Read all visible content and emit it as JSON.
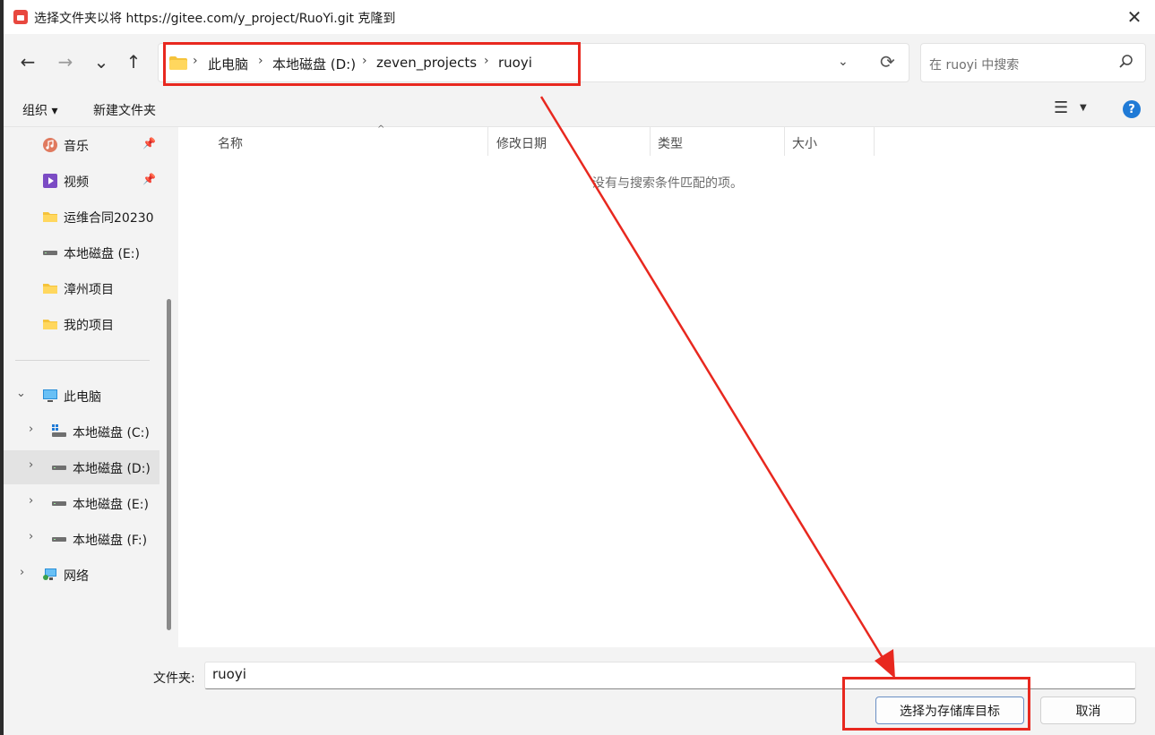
{
  "window": {
    "title": "选择文件夹以将 https://gitee.com/y_project/RuoYi.git 克隆到",
    "close_label": "✕"
  },
  "nav": {
    "back_icon": "←",
    "forward_icon": "→",
    "recent_icon": "⌄",
    "up_icon": "↑"
  },
  "address": {
    "crumbs": [
      "此电脑",
      "本地磁盘 (D:)",
      "zeven_projects",
      "ruoyi"
    ],
    "separator": "›",
    "dropdown_icon": "⌄",
    "refresh_icon": "⟳"
  },
  "search": {
    "placeholder": "在 ruoyi 中搜索",
    "icon": "search-icon"
  },
  "toolbar": {
    "organize_label": "组织 ▾",
    "new_folder_label": "新建文件夹",
    "view_icon": "☰",
    "view_dropdown": "▼",
    "help_label": "?"
  },
  "sidebar": {
    "items": [
      {
        "label": "音乐",
        "icon": "music-icon",
        "pinned": true
      },
      {
        "label": "视频",
        "icon": "video-icon",
        "pinned": true
      },
      {
        "label": "运维合同20230",
        "icon": "folder-icon"
      },
      {
        "label": "本地磁盘 (E:)",
        "icon": "drive-icon"
      },
      {
        "label": "漳州项目",
        "icon": "folder-icon"
      },
      {
        "label": "我的项目",
        "icon": "folder-icon"
      },
      {
        "label": "此电脑",
        "icon": "computer-icon",
        "expanded": true
      },
      {
        "label": "本地磁盘 (C:)",
        "icon": "windows-drive-icon"
      },
      {
        "label": "本地磁盘 (D:)",
        "icon": "drive-icon",
        "selected": true
      },
      {
        "label": "本地磁盘 (E:)",
        "icon": "drive-icon"
      },
      {
        "label": "本地磁盘 (F:)",
        "icon": "drive-icon"
      },
      {
        "label": "网络",
        "icon": "network-icon"
      }
    ],
    "pin_glyph": "📌",
    "chevron_right": "›",
    "chevron_down": "⌄"
  },
  "list": {
    "columns": [
      "名称",
      "修改日期",
      "类型",
      "大小"
    ],
    "sort_indicator": "^",
    "empty_message": "没有与搜索条件匹配的项。"
  },
  "footer": {
    "folder_label": "文件夹:",
    "folder_value": "ruoyi",
    "confirm_label": "选择为存储库目标",
    "cancel_label": "取消"
  },
  "colors": {
    "annotation": "#e8281f",
    "accent": "#1f7ad6"
  }
}
